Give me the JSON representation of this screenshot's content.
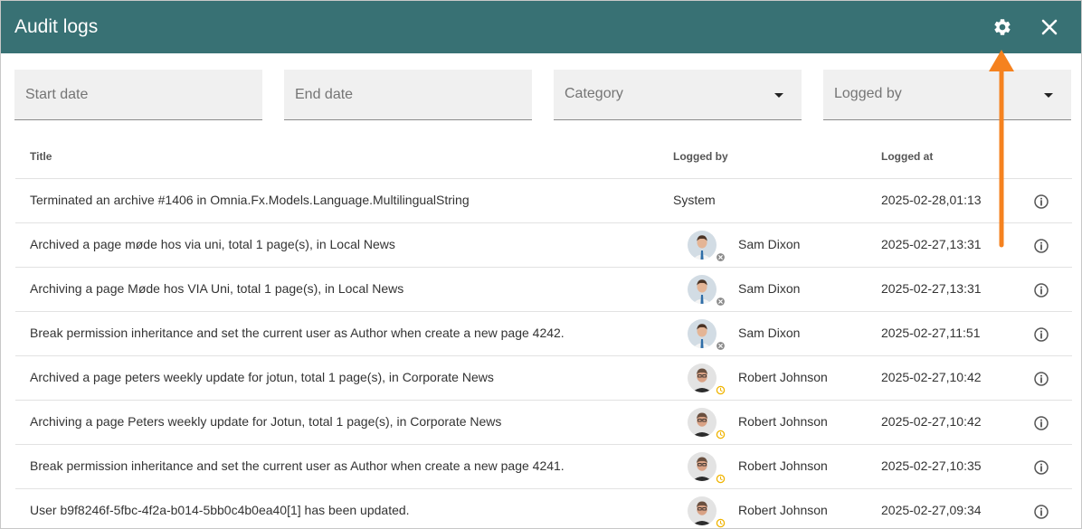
{
  "header": {
    "title": "Audit logs",
    "icons": [
      "gear-icon",
      "close-icon"
    ],
    "color": "#387174"
  },
  "filters": {
    "start_date": {
      "placeholder": "Start date"
    },
    "end_date": {
      "placeholder": "End date"
    },
    "category": {
      "label": "Category"
    },
    "logged_by": {
      "label": "Logged by"
    }
  },
  "table": {
    "columns": {
      "title": "Title",
      "logged_by": "Logged by",
      "logged_at": "Logged at"
    },
    "rows": [
      {
        "title": "Terminated an archive #1406 in Omnia.Fx.Models.Language.MultilingualString",
        "logged_by": "System",
        "logged_at": "2025-02-28,01:13"
      },
      {
        "title": "Archived a page møde hos via uni, total 1 page(s), in Local News",
        "logged_by": "Sam Dixon",
        "logged_at": "2025-02-27,13:31"
      },
      {
        "title": "Archiving a page Møde hos VIA Uni, total 1 page(s), in Local News",
        "logged_by": "Sam Dixon",
        "logged_at": "2025-02-27,13:31"
      },
      {
        "title": "Break permission inheritance and set the current user as Author when create a new page 4242.",
        "logged_by": "Sam Dixon",
        "logged_at": "2025-02-27,11:51"
      },
      {
        "title": "Archived a page peters weekly update for jotun, total 1 page(s), in Corporate News",
        "logged_by": "Robert Johnson",
        "logged_at": "2025-02-27,10:42"
      },
      {
        "title": "Archiving a page Peters weekly update for Jotun, total 1 page(s), in Corporate News",
        "logged_by": "Robert Johnson",
        "logged_at": "2025-02-27,10:42"
      },
      {
        "title": "Break permission inheritance and set the current user as Author when create a new page 4241.",
        "logged_by": "Robert Johnson",
        "logged_at": "2025-02-27,10:35"
      },
      {
        "title": "User b9f8246f-5fbc-4f2a-b014-5bb0c4b0ea40[1] has been updated.",
        "logged_by": "Robert Johnson",
        "logged_at": "2025-02-27,09:34"
      }
    ]
  },
  "annotation": {
    "color": "#f5821f"
  }
}
